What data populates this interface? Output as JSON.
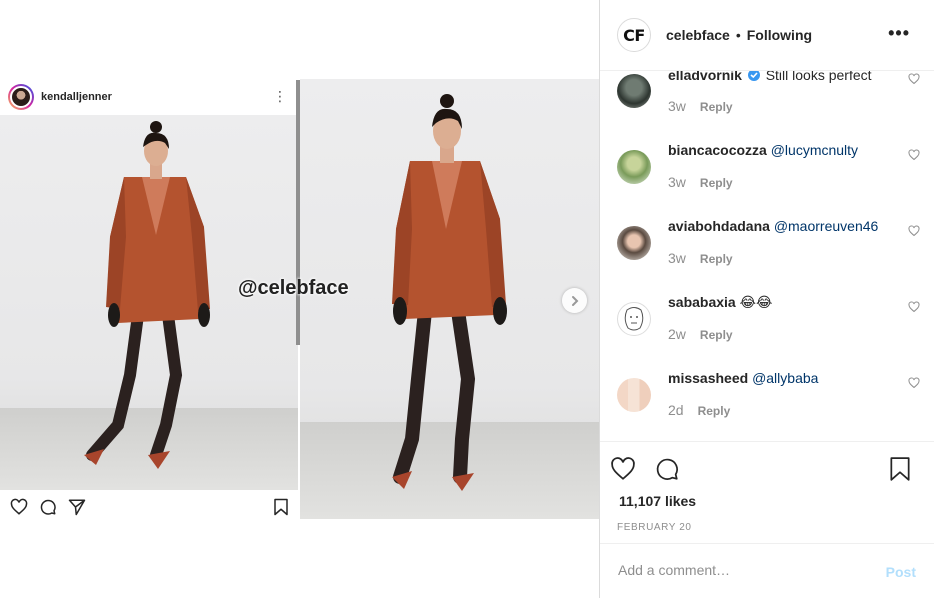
{
  "media": {
    "inner_post": {
      "username": "kendalljenner",
      "more_icon": "more-vertical-icon",
      "actions": [
        "heart-icon",
        "comment-icon",
        "share-icon",
        "bookmark-icon"
      ]
    },
    "watermark": "@celebface",
    "next_icon": "chevron-right-icon"
  },
  "header": {
    "avatar_text": "CF",
    "username": "celebface",
    "separator": "•",
    "follow_label": "Following",
    "more_icon": "more-horizontal-icon"
  },
  "comments": [
    {
      "user": "elladvornik",
      "verified": true,
      "text": "Still looks perfect",
      "mention": "",
      "age": "3w",
      "reply": "Reply"
    },
    {
      "user": "biancacocozza",
      "verified": false,
      "text": "",
      "mention": "@lucymcnulty",
      "age": "3w",
      "reply": "Reply"
    },
    {
      "user": "aviabohdadana",
      "verified": false,
      "text": "",
      "mention": "@maorreuven46",
      "age": "3w",
      "reply": "Reply"
    },
    {
      "user": "sababaxia",
      "verified": false,
      "text": "😂😂",
      "mention": "",
      "age": "2w",
      "reply": "Reply"
    },
    {
      "user": "missasheed",
      "verified": false,
      "text": "",
      "mention": "@allybaba",
      "age": "2d",
      "reply": "Reply"
    }
  ],
  "actions": {
    "icons": [
      "heart-icon",
      "comment-icon",
      "bookmark-icon"
    ],
    "likes": "11,107 likes",
    "date": "FEBRUARY 20"
  },
  "comment_box": {
    "placeholder": "Add a comment…",
    "post_label": "Post"
  },
  "colors": {
    "mention": "#003569",
    "post_disabled": "#b2dffc",
    "verified": "#3897f0",
    "secondary_text": "#8e8e8e"
  }
}
